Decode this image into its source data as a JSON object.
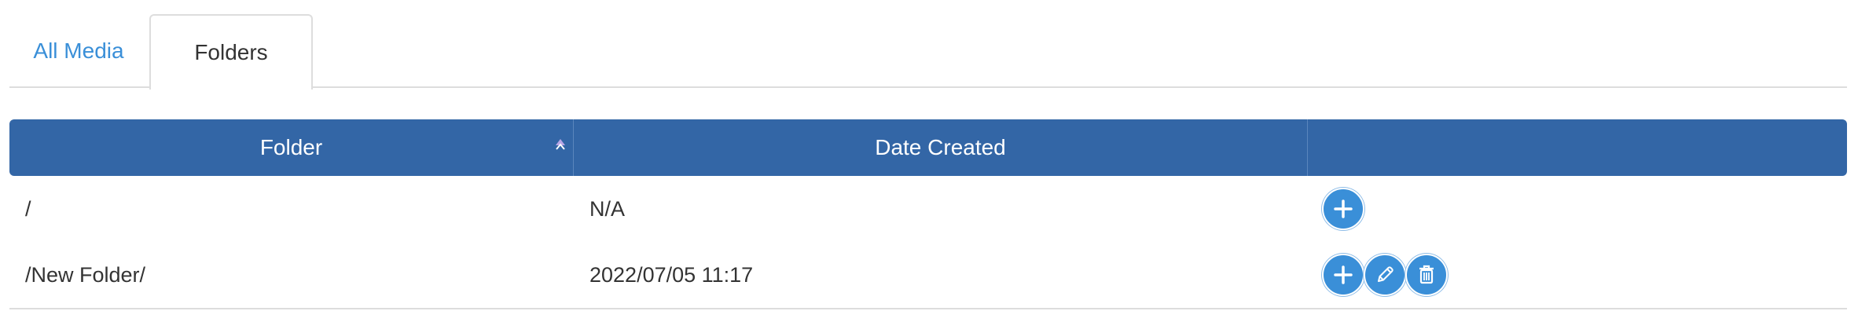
{
  "tabs": {
    "all_media": "All Media",
    "folders": "Folders"
  },
  "table": {
    "columns": {
      "folder": "Folder",
      "date_created": "Date Created"
    },
    "rows": [
      {
        "folder": "/",
        "date_created": "N/A",
        "actions": [
          "add"
        ]
      },
      {
        "folder": "/New Folder/",
        "date_created": "2022/07/05 11:17",
        "actions": [
          "add",
          "edit",
          "delete"
        ]
      }
    ]
  },
  "icons": {
    "sort": "sort-ascending-icon",
    "add": "plus-icon",
    "edit": "pencil-icon",
    "delete": "trash-icon"
  },
  "colors": {
    "header_bg": "#3366a6",
    "tab_link": "#3a8fd8",
    "action_button": "#3a8fd8"
  }
}
